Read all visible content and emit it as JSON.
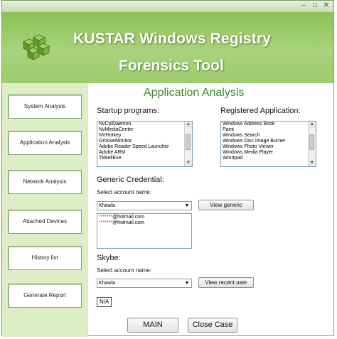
{
  "window": {
    "controls": [
      "–",
      "□",
      "✕"
    ]
  },
  "header": {
    "title_line1": "KUSTAR Windows Registry",
    "title_line2": "Forensics Tool"
  },
  "sidebar": {
    "items": [
      {
        "label": "System Analysis"
      },
      {
        "label": "Application Analysis"
      },
      {
        "label": "Network Analysis"
      },
      {
        "label": "Attached Devices"
      },
      {
        "label": "History list"
      },
      {
        "label": "Generate Report"
      }
    ]
  },
  "main": {
    "heading": "Application Analysis",
    "startup": {
      "label": "Startup programs:",
      "items": [
        "NvCplDaemon",
        "NvMediaCenter",
        "NVHotkey",
        "GrooveMonitor",
        "Adobe Reader Speed Launcher",
        "Adobe ARM",
        "TkBellExe"
      ]
    },
    "registered": {
      "label": "Registered Application:",
      "items": [
        "Windows Address Book",
        "Paint",
        "Windows Search",
        "Windows Disc Image Burner",
        "Windows Photo Viewer",
        "Windows Media Player",
        "Wordpad"
      ]
    },
    "generic": {
      "label": "Generic Credential:",
      "select_label": "Select account name:",
      "selected": "Khawla",
      "button": "View generic",
      "accounts": [
        {
          "redacted": "*******",
          "domain": "@hotmail.com"
        },
        {
          "redacted": "*******",
          "domain": "@hotmail.com"
        }
      ]
    },
    "skype": {
      "label": "Skybe:",
      "select_label": "Select account name:",
      "selected": "Khawla",
      "button": "View recent user",
      "result": "N/A"
    },
    "buttons": {
      "main": "MAIN",
      "close": "Close Case"
    }
  }
}
